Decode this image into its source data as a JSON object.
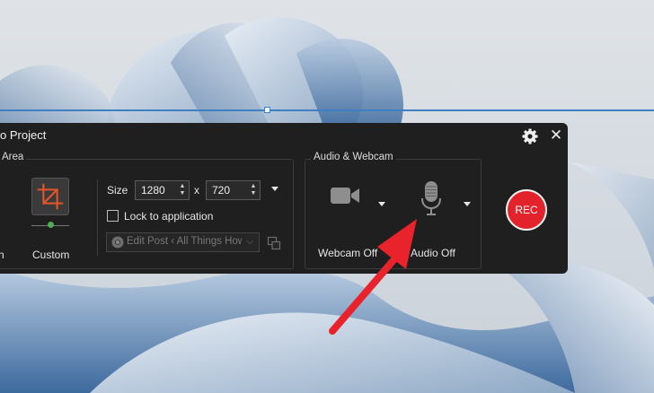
{
  "window": {
    "title": "o Project",
    "settings_icon": "gear-icon",
    "close_glyph": "✕"
  },
  "screen_area": {
    "group_label": "Area",
    "custom_label": "Custom",
    "partial_label": "n",
    "size_label": "Size",
    "width": "1280",
    "height": "720",
    "times": "x",
    "lock_label": "Lock to application",
    "lock_checked": false,
    "app_dropdown_value": "Edit Post ‹ All Things How"
  },
  "audio_webcam": {
    "group_label": "Audio & Webcam",
    "webcam_label": "Webcam Off",
    "audio_label": "Audio Off"
  },
  "rec_label": "REC",
  "colors": {
    "accent_orange": "#e8542a",
    "rec_red": "#e3232b",
    "arrow_red": "#e8232b",
    "selection_blue": "#3f7fc2",
    "panel_bg": "#1f1f1f"
  }
}
